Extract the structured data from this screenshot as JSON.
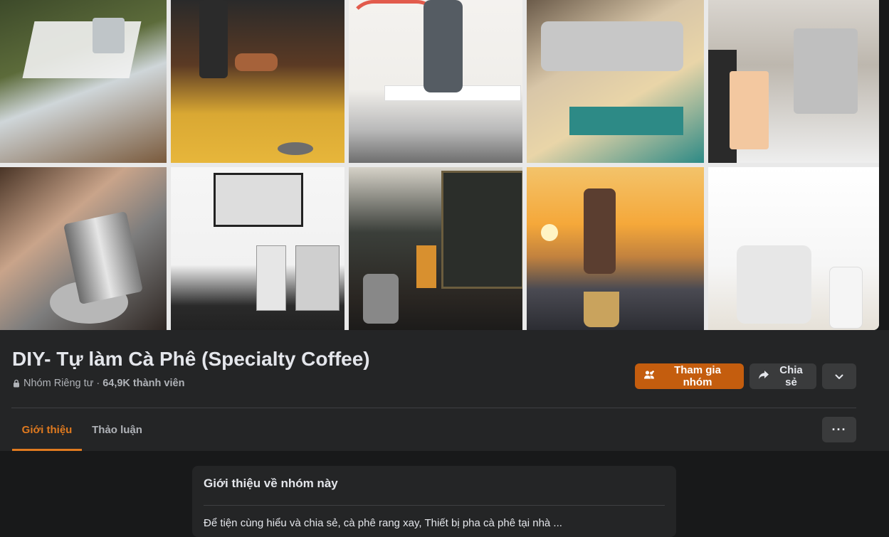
{
  "group": {
    "name": "DIY- Tự làm Cà Phê (Specialty Coffee)",
    "privacy": "Nhóm Riêng tư",
    "separator": "·",
    "members": "64,9K thành viên"
  },
  "actions": {
    "join_label": "Tham gia nhóm",
    "share_label": "Chia sẻ"
  },
  "tabs": [
    {
      "label": "Giới thiệu",
      "active": true
    },
    {
      "label": "Thảo luận",
      "active": false
    }
  ],
  "about_card": {
    "title": "Giới thiệu về nhóm này",
    "text": "Để tiện cùng hiểu và chia sẻ, cà phê rang xay, Thiết bị pha cà phê tại nhà ..."
  },
  "colors": {
    "accent": "#c45d0e",
    "active_tab": "#e07a1f",
    "background": "#18191a",
    "surface": "#242526"
  },
  "icons": {
    "lock": "lock-icon",
    "join": "people-icon",
    "share": "share-arrow-icon",
    "more": "chevron-down-icon",
    "dots": "more-dots-icon"
  },
  "more_dots": "···"
}
